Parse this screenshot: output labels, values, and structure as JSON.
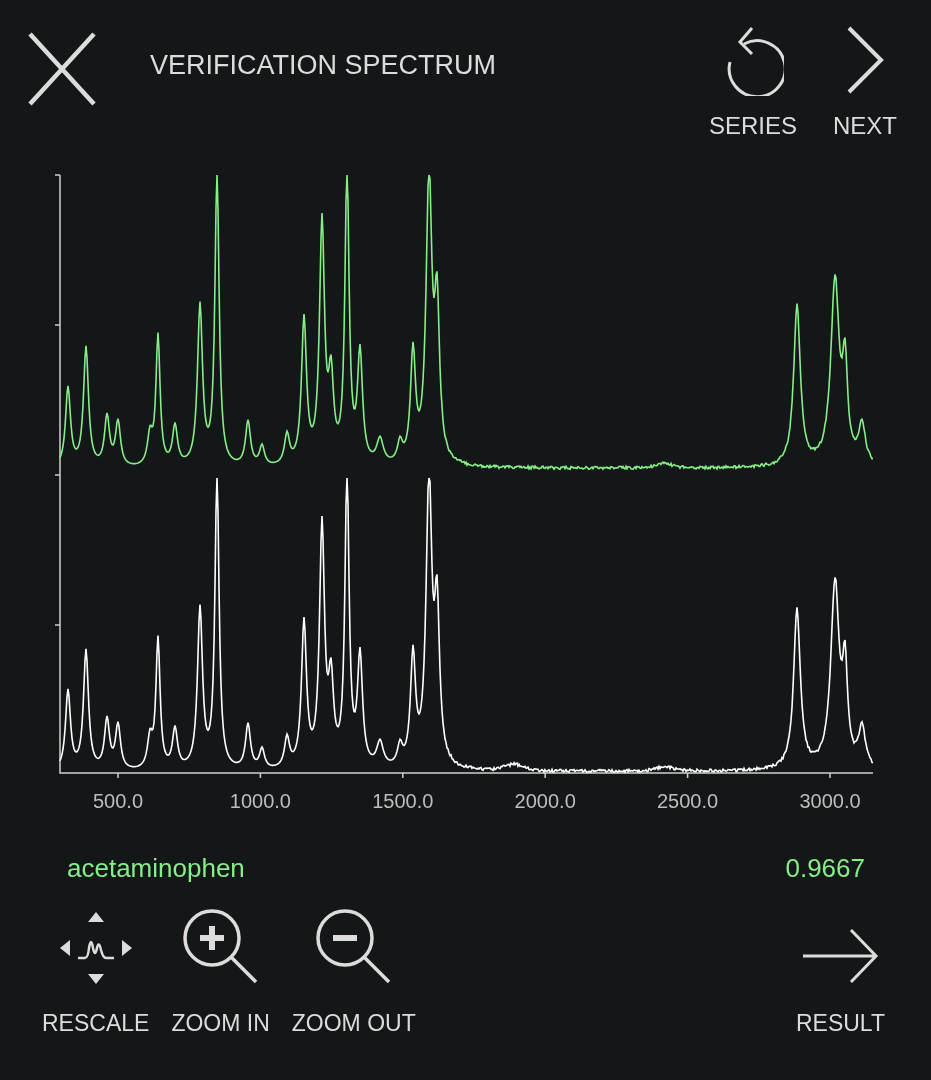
{
  "header": {
    "title": "VERIFICATION SPECTRUM",
    "actions": [
      {
        "kind": "series",
        "label": "SERIES"
      },
      {
        "kind": "next",
        "label": "NEXT"
      }
    ]
  },
  "spectrum_view": {
    "x_tick_labels": [
      "500.0",
      "1000.0",
      "1500.0",
      "2000.0",
      "2500.0",
      "3000.0"
    ],
    "spectra": [
      {
        "color": "#86ee86"
      },
      {
        "color": "#ffffff"
      }
    ]
  },
  "match": {
    "name": "acetaminophen",
    "score": "0.9667"
  },
  "toolbar": [
    {
      "kind": "rescale",
      "label": "RESCALE"
    },
    {
      "kind": "zoom_in",
      "label": "ZOOM IN"
    },
    {
      "kind": "zoom_out",
      "label": "ZOOM OUT"
    },
    {
      "kind": "result",
      "label": "RESULT"
    }
  ]
}
